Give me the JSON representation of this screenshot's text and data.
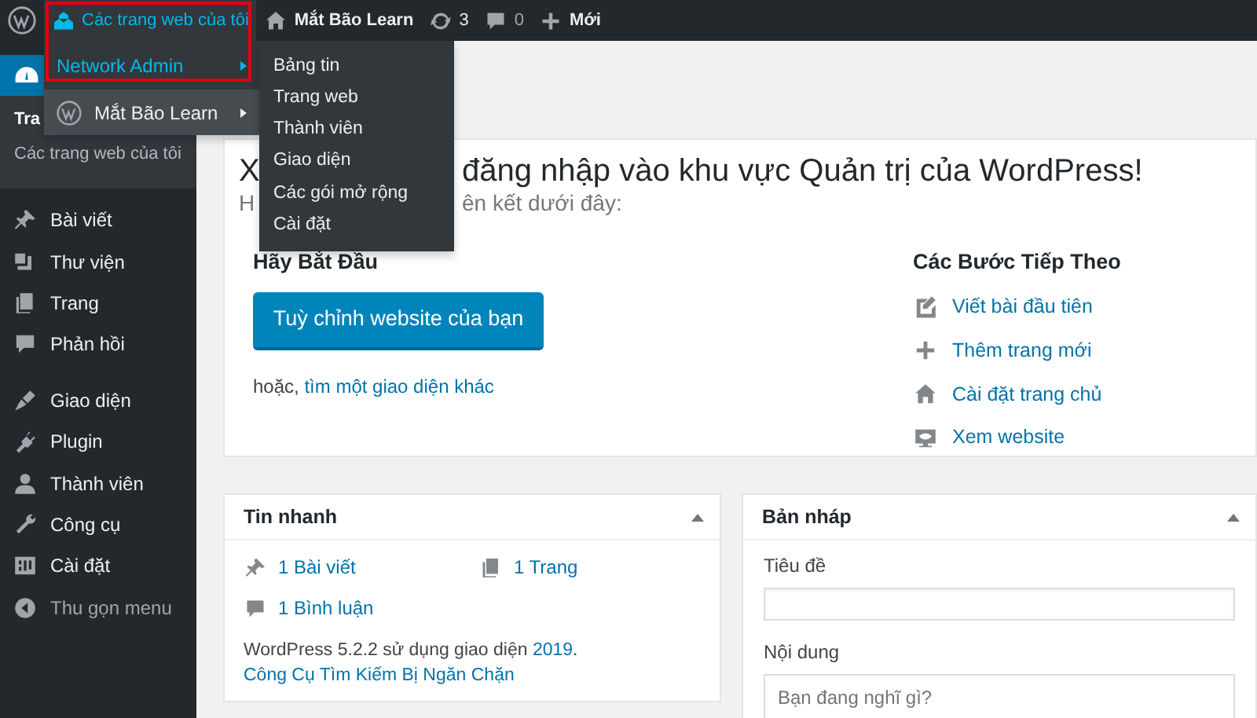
{
  "admin_bar": {
    "items": [
      {
        "kind": "logo"
      },
      {
        "kind": "sites",
        "label": "Các trang web của tôi"
      },
      {
        "kind": "home",
        "label": "Mắt Bão Learn"
      },
      {
        "kind": "updates",
        "label": "3"
      },
      {
        "kind": "comments",
        "label": "0"
      },
      {
        "kind": "new",
        "label": "Mới"
      }
    ]
  },
  "red_frame": true,
  "sites_menu": [
    {
      "kind": "network",
      "label": "Network Admin",
      "expanded": true
    },
    {
      "kind": "site",
      "label": "Mắt Bão Learn",
      "expanded": false
    }
  ],
  "network_submenu": [
    "Bảng tin",
    "Trang web",
    "Thành viên",
    "Giao diện",
    "Các gói mở rộng",
    "Cài đặt"
  ],
  "sidebar": {
    "current": {
      "kind": "dashboard",
      "selected": true
    },
    "submenu": [
      {
        "label": "Tra",
        "selected": true
      },
      {
        "label": "Các trang web của tôi",
        "selected": false
      }
    ],
    "items": [
      {
        "kind": "post",
        "label": "Bài viết"
      },
      {
        "kind": "media",
        "label": "Thư viện"
      },
      {
        "kind": "page",
        "label": "Trang"
      },
      {
        "kind": "comment",
        "label": "Phản hồi"
      },
      {
        "kind": "separator"
      },
      {
        "kind": "appearance",
        "label": "Giao diện"
      },
      {
        "kind": "plugin",
        "label": "Plugin"
      },
      {
        "kind": "user",
        "label": "Thành viên"
      },
      {
        "kind": "tool",
        "label": "Công cụ"
      },
      {
        "kind": "settings",
        "label": "Cài đặt"
      },
      {
        "kind": "collapse",
        "label": "Thu gọn menu"
      }
    ]
  },
  "welcome": {
    "heading_parts": [
      "X",
      "đăng nhập vào khu vực Quản trị của WordPress!"
    ],
    "subtitle_parts": [
      "H",
      "ên kết dưới đây:"
    ],
    "get_started": {
      "title": "Hãy Bắt Đầu",
      "button": "Tuỳ chỉnh website của bạn",
      "alt_prefix": "hoặc,",
      "alt_link": "tìm một giao diện khác"
    },
    "next_steps": {
      "title": "Các Bước Tiếp Theo",
      "items": [
        {
          "kind": "edit",
          "label": "Viết bài đầu tiên"
        },
        {
          "kind": "plus",
          "label": "Thêm trang mới"
        },
        {
          "kind": "home",
          "label": "Cài đặt trang chủ"
        },
        {
          "kind": "view",
          "label": "Xem website"
        }
      ]
    }
  },
  "at_a_glance": {
    "title": "Tin nhanh",
    "items": [
      {
        "kind": "post",
        "label": "1 Bài viết"
      },
      {
        "kind": "page",
        "label": "1 Trang"
      },
      {
        "kind": "comment",
        "label": "1 Bình luận"
      }
    ],
    "footer": {
      "before": "WordPress 5.2.2 sử dụng giao diện",
      "link": "2019",
      "after": "."
    },
    "notice_link": "Công Cụ Tìm Kiếm Bị Ngăn Chặn"
  },
  "quick_draft": {
    "title": "Bản nháp",
    "title_label": "Tiêu đề",
    "content_label": "Nội dung",
    "content_placeholder": "Bạn đang nghĩ gì?"
  }
}
